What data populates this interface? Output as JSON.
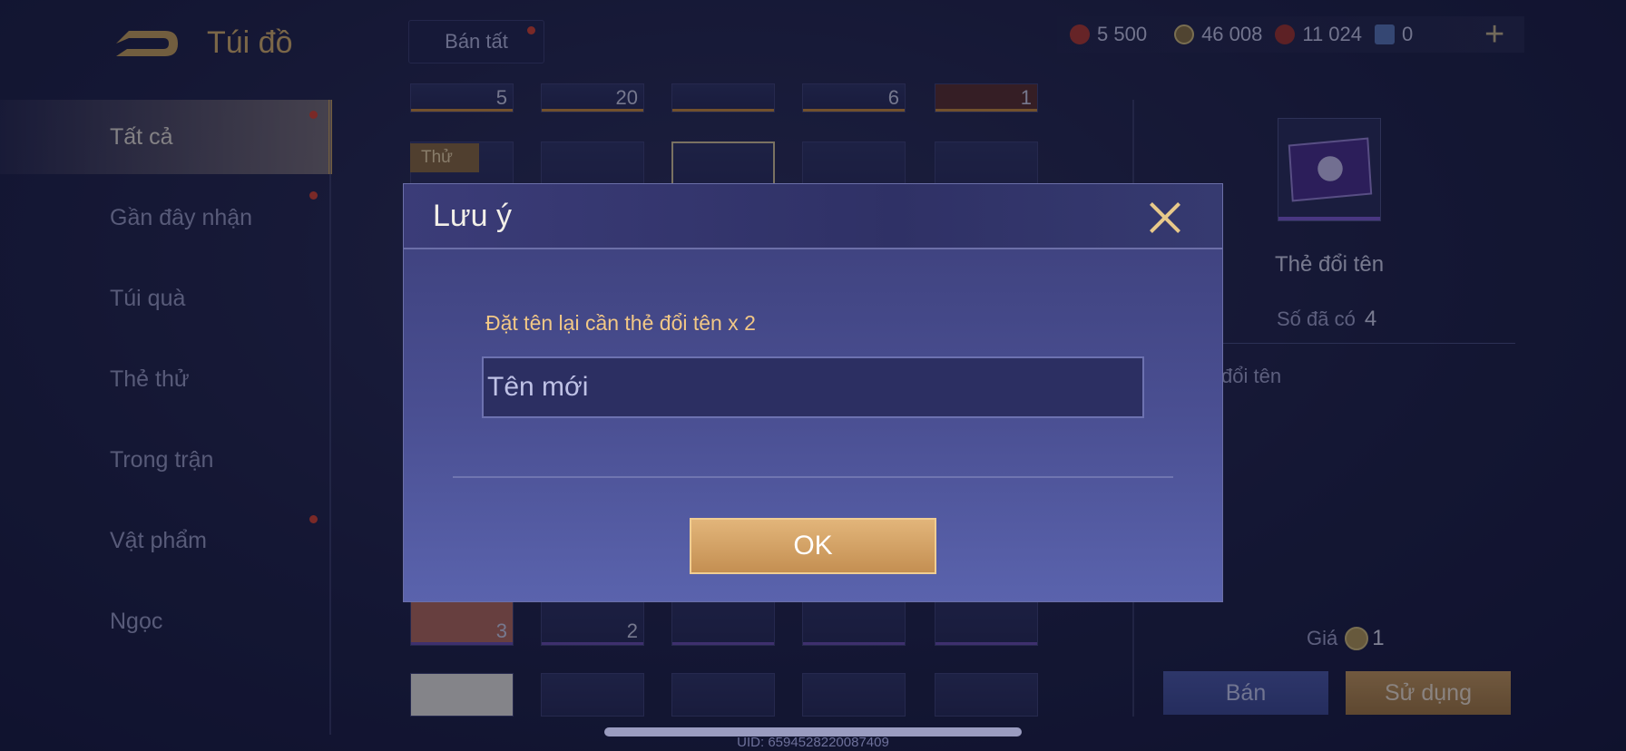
{
  "header": {
    "title": "Túi đồ",
    "sell_all_label": "Bán tất",
    "currencies": [
      {
        "icon": "ruby-icon",
        "value": "5 500",
        "color": "#c0392b"
      },
      {
        "icon": "gold-coin-icon",
        "value": "46 008",
        "color": "#b59a54"
      },
      {
        "icon": "voucher-icon",
        "value": "11 024",
        "color": "#c0392b"
      },
      {
        "icon": "card-icon",
        "value": "0",
        "color": "#6f8fd0"
      }
    ],
    "add_label": "+"
  },
  "sidebar": {
    "items": [
      {
        "label": "Tất cả",
        "active": true,
        "dot": true
      },
      {
        "label": "Gần đây nhận",
        "active": false,
        "dot": true
      },
      {
        "label": "Túi quà",
        "active": false,
        "dot": false
      },
      {
        "label": "Thẻ thử",
        "active": false,
        "dot": false
      },
      {
        "label": "Trong trận",
        "active": false,
        "dot": false
      },
      {
        "label": "Vật phẩm",
        "active": false,
        "dot": true
      },
      {
        "label": "Ngọc",
        "active": false,
        "dot": false
      }
    ]
  },
  "grid": {
    "try_tag": "Thử",
    "row_top_qty": [
      "5",
      "20",
      "",
      "6",
      "1"
    ],
    "row_bottom_qty": [
      "3",
      "2",
      "",
      "",
      ""
    ]
  },
  "detail": {
    "name": "Thẻ đổi tên",
    "owned_label": "Số đã có",
    "owned_value": "4",
    "description": "đổi tên",
    "price_label": "Giá",
    "price_value": "1",
    "sell_label": "Bán",
    "use_label": "Sử dụng"
  },
  "modal": {
    "title": "Lưu ý",
    "message": "Đặt tên lại cần thẻ đổi tên x 2",
    "input_placeholder": "Tên mới",
    "ok_label": "OK"
  },
  "footer": {
    "uid": "UID: 6594528220087409"
  }
}
